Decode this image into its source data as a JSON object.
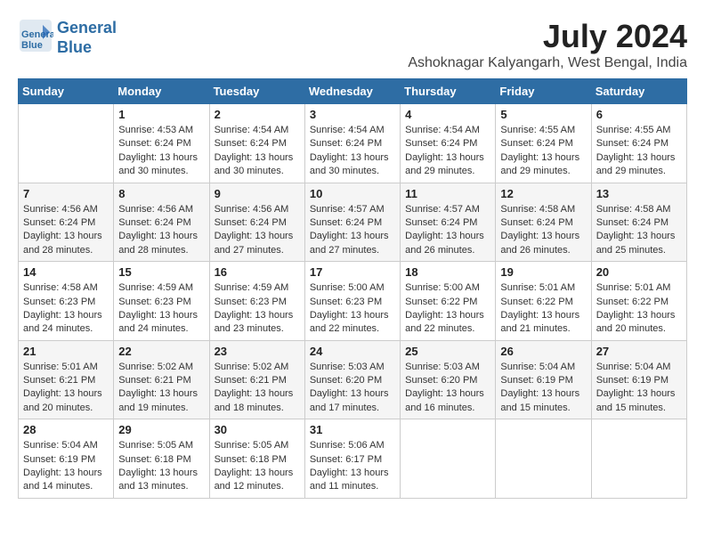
{
  "header": {
    "logo_line1": "General",
    "logo_line2": "Blue",
    "month_year": "July 2024",
    "location": "Ashoknagar Kalyangarh, West Bengal, India"
  },
  "days_of_week": [
    "Sunday",
    "Monday",
    "Tuesday",
    "Wednesday",
    "Thursday",
    "Friday",
    "Saturday"
  ],
  "weeks": [
    [
      {
        "day": "",
        "sunrise": "",
        "sunset": "",
        "daylight": ""
      },
      {
        "day": "1",
        "sunrise": "Sunrise: 4:53 AM",
        "sunset": "Sunset: 6:24 PM",
        "daylight": "Daylight: 13 hours and 30 minutes."
      },
      {
        "day": "2",
        "sunrise": "Sunrise: 4:54 AM",
        "sunset": "Sunset: 6:24 PM",
        "daylight": "Daylight: 13 hours and 30 minutes."
      },
      {
        "day": "3",
        "sunrise": "Sunrise: 4:54 AM",
        "sunset": "Sunset: 6:24 PM",
        "daylight": "Daylight: 13 hours and 30 minutes."
      },
      {
        "day": "4",
        "sunrise": "Sunrise: 4:54 AM",
        "sunset": "Sunset: 6:24 PM",
        "daylight": "Daylight: 13 hours and 29 minutes."
      },
      {
        "day": "5",
        "sunrise": "Sunrise: 4:55 AM",
        "sunset": "Sunset: 6:24 PM",
        "daylight": "Daylight: 13 hours and 29 minutes."
      },
      {
        "day": "6",
        "sunrise": "Sunrise: 4:55 AM",
        "sunset": "Sunset: 6:24 PM",
        "daylight": "Daylight: 13 hours and 29 minutes."
      }
    ],
    [
      {
        "day": "7",
        "sunrise": "Sunrise: 4:56 AM",
        "sunset": "Sunset: 6:24 PM",
        "daylight": "Daylight: 13 hours and 28 minutes."
      },
      {
        "day": "8",
        "sunrise": "Sunrise: 4:56 AM",
        "sunset": "Sunset: 6:24 PM",
        "daylight": "Daylight: 13 hours and 28 minutes."
      },
      {
        "day": "9",
        "sunrise": "Sunrise: 4:56 AM",
        "sunset": "Sunset: 6:24 PM",
        "daylight": "Daylight: 13 hours and 27 minutes."
      },
      {
        "day": "10",
        "sunrise": "Sunrise: 4:57 AM",
        "sunset": "Sunset: 6:24 PM",
        "daylight": "Daylight: 13 hours and 27 minutes."
      },
      {
        "day": "11",
        "sunrise": "Sunrise: 4:57 AM",
        "sunset": "Sunset: 6:24 PM",
        "daylight": "Daylight: 13 hours and 26 minutes."
      },
      {
        "day": "12",
        "sunrise": "Sunrise: 4:58 AM",
        "sunset": "Sunset: 6:24 PM",
        "daylight": "Daylight: 13 hours and 26 minutes."
      },
      {
        "day": "13",
        "sunrise": "Sunrise: 4:58 AM",
        "sunset": "Sunset: 6:24 PM",
        "daylight": "Daylight: 13 hours and 25 minutes."
      }
    ],
    [
      {
        "day": "14",
        "sunrise": "Sunrise: 4:58 AM",
        "sunset": "Sunset: 6:23 PM",
        "daylight": "Daylight: 13 hours and 24 minutes."
      },
      {
        "day": "15",
        "sunrise": "Sunrise: 4:59 AM",
        "sunset": "Sunset: 6:23 PM",
        "daylight": "Daylight: 13 hours and 24 minutes."
      },
      {
        "day": "16",
        "sunrise": "Sunrise: 4:59 AM",
        "sunset": "Sunset: 6:23 PM",
        "daylight": "Daylight: 13 hours and 23 minutes."
      },
      {
        "day": "17",
        "sunrise": "Sunrise: 5:00 AM",
        "sunset": "Sunset: 6:23 PM",
        "daylight": "Daylight: 13 hours and 22 minutes."
      },
      {
        "day": "18",
        "sunrise": "Sunrise: 5:00 AM",
        "sunset": "Sunset: 6:22 PM",
        "daylight": "Daylight: 13 hours and 22 minutes."
      },
      {
        "day": "19",
        "sunrise": "Sunrise: 5:01 AM",
        "sunset": "Sunset: 6:22 PM",
        "daylight": "Daylight: 13 hours and 21 minutes."
      },
      {
        "day": "20",
        "sunrise": "Sunrise: 5:01 AM",
        "sunset": "Sunset: 6:22 PM",
        "daylight": "Daylight: 13 hours and 20 minutes."
      }
    ],
    [
      {
        "day": "21",
        "sunrise": "Sunrise: 5:01 AM",
        "sunset": "Sunset: 6:21 PM",
        "daylight": "Daylight: 13 hours and 20 minutes."
      },
      {
        "day": "22",
        "sunrise": "Sunrise: 5:02 AM",
        "sunset": "Sunset: 6:21 PM",
        "daylight": "Daylight: 13 hours and 19 minutes."
      },
      {
        "day": "23",
        "sunrise": "Sunrise: 5:02 AM",
        "sunset": "Sunset: 6:21 PM",
        "daylight": "Daylight: 13 hours and 18 minutes."
      },
      {
        "day": "24",
        "sunrise": "Sunrise: 5:03 AM",
        "sunset": "Sunset: 6:20 PM",
        "daylight": "Daylight: 13 hours and 17 minutes."
      },
      {
        "day": "25",
        "sunrise": "Sunrise: 5:03 AM",
        "sunset": "Sunset: 6:20 PM",
        "daylight": "Daylight: 13 hours and 16 minutes."
      },
      {
        "day": "26",
        "sunrise": "Sunrise: 5:04 AM",
        "sunset": "Sunset: 6:19 PM",
        "daylight": "Daylight: 13 hours and 15 minutes."
      },
      {
        "day": "27",
        "sunrise": "Sunrise: 5:04 AM",
        "sunset": "Sunset: 6:19 PM",
        "daylight": "Daylight: 13 hours and 15 minutes."
      }
    ],
    [
      {
        "day": "28",
        "sunrise": "Sunrise: 5:04 AM",
        "sunset": "Sunset: 6:19 PM",
        "daylight": "Daylight: 13 hours and 14 minutes."
      },
      {
        "day": "29",
        "sunrise": "Sunrise: 5:05 AM",
        "sunset": "Sunset: 6:18 PM",
        "daylight": "Daylight: 13 hours and 13 minutes."
      },
      {
        "day": "30",
        "sunrise": "Sunrise: 5:05 AM",
        "sunset": "Sunset: 6:18 PM",
        "daylight": "Daylight: 13 hours and 12 minutes."
      },
      {
        "day": "31",
        "sunrise": "Sunrise: 5:06 AM",
        "sunset": "Sunset: 6:17 PM",
        "daylight": "Daylight: 13 hours and 11 minutes."
      },
      {
        "day": "",
        "sunrise": "",
        "sunset": "",
        "daylight": ""
      },
      {
        "day": "",
        "sunrise": "",
        "sunset": "",
        "daylight": ""
      },
      {
        "day": "",
        "sunrise": "",
        "sunset": "",
        "daylight": ""
      }
    ]
  ]
}
